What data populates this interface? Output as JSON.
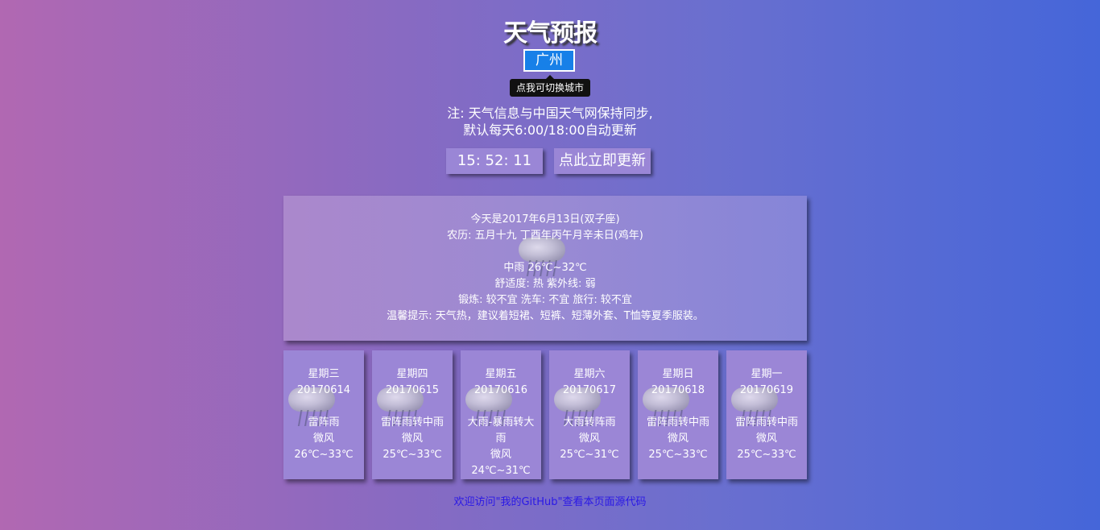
{
  "header": {
    "title": "天气预报",
    "city": "广州",
    "tooltip": "点我可切换城市"
  },
  "note": {
    "line1": "注: 天气信息与中国天气网保持同步,",
    "line2": "默认每天6:00/18:00自动更新"
  },
  "controls": {
    "clock": "15: 52: 11",
    "refresh_label": "点此立即更新"
  },
  "today": {
    "date": "今天是2017年6月13日(双子座)",
    "lunar": "农历: 五月十九 丁酉年丙午月辛未日(鸡年)",
    "weather": "中雨 26℃~32℃",
    "comfort": "舒适度: 热 紫外线: 弱",
    "activities": "锻炼: 较不宜 洗车: 不宜 旅行: 较不宜",
    "tip": "温馨提示: 天气热，建议着短裙、短裤、短薄外套、T恤等夏季服装。",
    "icon": "rain-cloud-icon"
  },
  "forecast": [
    {
      "weekday": "星期三",
      "date": "20170614",
      "weather": "雷阵雨",
      "wind": "微风",
      "temp": "26℃~33℃",
      "icon": "thunder-rain-icon"
    },
    {
      "weekday": "星期四",
      "date": "20170615",
      "weather": "雷阵雨转中雨",
      "wind": "微风",
      "temp": "25℃~33℃",
      "icon": "thunder-rain-icon"
    },
    {
      "weekday": "星期五",
      "date": "20170616",
      "weather_l1": "大雨-暴雨转大",
      "weather_l2": "雨",
      "wind": "微风",
      "temp": "24℃~31℃",
      "icon": "heavy-rain-icon"
    },
    {
      "weekday": "星期六",
      "date": "20170617",
      "weather": "大雨转阵雨",
      "wind": "微风",
      "temp": "25℃~31℃",
      "icon": "heavy-rain-icon"
    },
    {
      "weekday": "星期日",
      "date": "20170618",
      "weather": "雷阵雨转中雨",
      "wind": "微风",
      "temp": "25℃~33℃",
      "icon": "thunder-rain-icon"
    },
    {
      "weekday": "星期一",
      "date": "20170619",
      "weather": "雷阵雨转中雨",
      "wind": "微风",
      "temp": "25℃~33℃",
      "icon": "thunder-rain-icon"
    }
  ],
  "footer": {
    "link_text": "欢迎访问\"我的GitHub\"查看本页面源代码",
    "link_color": "#2a18e6"
  }
}
